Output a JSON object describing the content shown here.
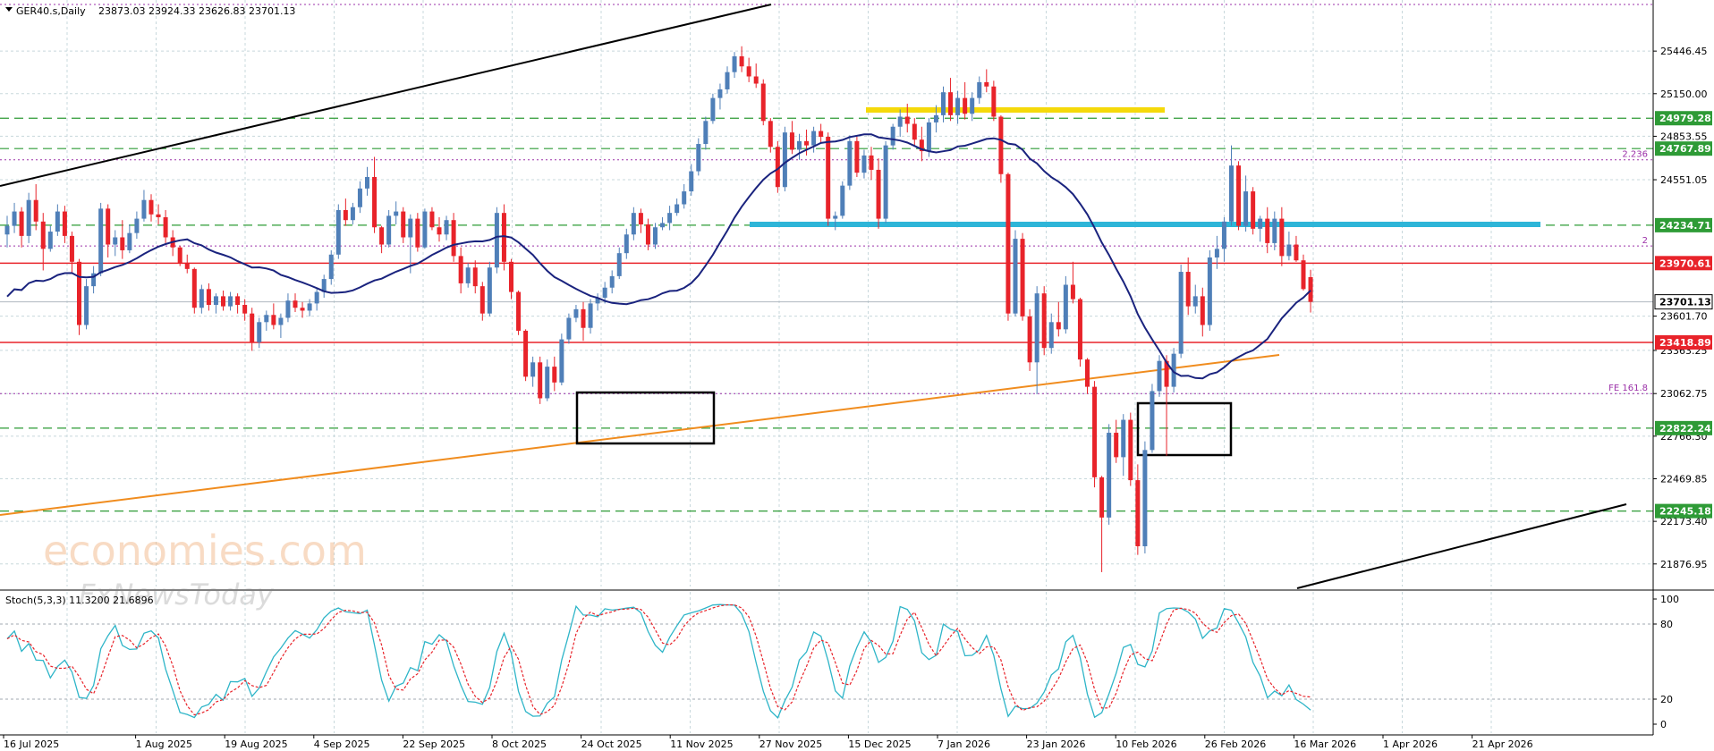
{
  "header": {
    "symbol": "GER40.s,Daily",
    "ohlc": "23873.03 23924.33 23626.83 23701.13",
    "menu_icon": "triangle-down-icon"
  },
  "watermark": {
    "line1": "economies.com",
    "line2": "FxNewsToday"
  },
  "indicator": {
    "title": "Stoch(5,3,3) 11.3200 21.6896"
  },
  "colors": {
    "background": "#ffffff",
    "grid": "#c8d8dc",
    "bull": "#4f7fb8",
    "bear": "#e8232a",
    "ma": "#1a237e",
    "support_red": "#e8232a",
    "green_level": "#2e9b36",
    "yellow_zone": "#f5d90a",
    "cyan_zone": "#2eb5d8",
    "orange_trend": "#f08c1e",
    "channel": "#000000",
    "fib": "#9b30a8",
    "stoch_main": "#2eb5c8",
    "stoch_signal": "#e8232a"
  },
  "chart_data": {
    "type": "candlestick",
    "symbol": "GER40.s",
    "timeframe": "Daily",
    "y_range": [
      21720,
      25690
    ],
    "price_labels": [
      "25446.45",
      "25150.00",
      "24853.55",
      "24551.05",
      "23601.70",
      "23363.25",
      "23062.75",
      "22766.30",
      "22469.85",
      "22173.40",
      "21876.95"
    ],
    "hidden_price_labels": [
      25150.0,
      24551.05,
      23601.7,
      23363.25,
      22766.3,
      22173.4
    ],
    "dates": [
      "16 Jul 2025",
      "1 Aug 2025",
      "19 Aug 2025",
      "4 Sep 2025",
      "22 Sep 2025",
      "8 Oct 2025",
      "24 Oct 2025",
      "11 Nov 2025",
      "27 Nov 2025",
      "15 Dec 2025",
      "7 Jan 2026",
      "23 Jan 2026",
      "10 Feb 2026",
      "26 Feb 2026",
      "16 Mar 2026",
      "1 Apr 2026",
      "21 Apr 2026"
    ],
    "level_lines": [
      {
        "price": 24979.28,
        "label": "24979.28",
        "style": "green-dashed"
      },
      {
        "price": 24767.89,
        "label": "24767.89",
        "style": "green-dashed"
      },
      {
        "price": 24234.71,
        "label": "24234.71",
        "style": "green-dashed"
      },
      {
        "price": 23970.61,
        "label": "23970.61",
        "style": "red-solid"
      },
      {
        "price": 23701.13,
        "label": "23701.13",
        "style": "current"
      },
      {
        "price": 23418.89,
        "label": "23418.89",
        "style": "red-solid"
      },
      {
        "price": 22822.24,
        "label": "22822.24",
        "style": "green-dashed"
      },
      {
        "price": 22245.18,
        "label": "22245.18",
        "style": "green-dashed"
      }
    ],
    "fib_lines": [
      {
        "price": 24690,
        "label": "2.236"
      },
      {
        "price": 24090,
        "label": "2"
      },
      {
        "price": 23062.75,
        "label": "FE 161.8"
      }
    ],
    "candles": [
      [
        24170,
        24300,
        24080,
        24230
      ],
      [
        24230,
        24390,
        24180,
        24330
      ],
      [
        24330,
        24360,
        24080,
        24160
      ],
      [
        24160,
        24460,
        24110,
        24410
      ],
      [
        24410,
        24520,
        24200,
        24260
      ],
      [
        24260,
        24320,
        23920,
        24070
      ],
      [
        24070,
        24230,
        24050,
        24190
      ],
      [
        24190,
        24380,
        24160,
        24330
      ],
      [
        24330,
        24370,
        24110,
        24160
      ],
      [
        24160,
        24190,
        23900,
        23980
      ],
      [
        23980,
        24000,
        23470,
        23540
      ],
      [
        23540,
        23860,
        23510,
        23810
      ],
      [
        23810,
        23950,
        23760,
        23900
      ],
      [
        23900,
        24390,
        23880,
        24350
      ],
      [
        24350,
        24380,
        24010,
        24100
      ],
      [
        24100,
        24200,
        24020,
        24150
      ],
      [
        24150,
        24270,
        24000,
        24060
      ],
      [
        24060,
        24240,
        24040,
        24180
      ],
      [
        24180,
        24330,
        24140,
        24280
      ],
      [
        24280,
        24480,
        24260,
        24410
      ],
      [
        24410,
        24450,
        24260,
        24310
      ],
      [
        24310,
        24380,
        24240,
        24290
      ],
      [
        24290,
        24340,
        24110,
        24150
      ],
      [
        24150,
        24200,
        24020,
        24080
      ],
      [
        24080,
        24090,
        23950,
        23970
      ],
      [
        23970,
        24030,
        23900,
        23930
      ],
      [
        23930,
        23940,
        23620,
        23660
      ],
      [
        23660,
        23820,
        23620,
        23790
      ],
      [
        23790,
        23830,
        23640,
        23680
      ],
      [
        23680,
        23760,
        23620,
        23740
      ],
      [
        23740,
        23780,
        23640,
        23670
      ],
      [
        23670,
        23770,
        23640,
        23740
      ],
      [
        23740,
        23760,
        23620,
        23680
      ],
      [
        23680,
        23720,
        23570,
        23620
      ],
      [
        23620,
        23660,
        23360,
        23420
      ],
      [
        23420,
        23590,
        23380,
        23560
      ],
      [
        23560,
        23640,
        23500,
        23610
      ],
      [
        23610,
        23690,
        23510,
        23540
      ],
      [
        23540,
        23620,
        23450,
        23590
      ],
      [
        23590,
        23760,
        23560,
        23710
      ],
      [
        23710,
        23760,
        23630,
        23660
      ],
      [
        23660,
        23700,
        23590,
        23640
      ],
      [
        23640,
        23720,
        23600,
        23690
      ],
      [
        23690,
        23800,
        23640,
        23770
      ],
      [
        23770,
        23890,
        23730,
        23860
      ],
      [
        23860,
        24060,
        23820,
        24030
      ],
      [
        24030,
        24380,
        24000,
        24340
      ],
      [
        24340,
        24420,
        24230,
        24270
      ],
      [
        24270,
        24390,
        24240,
        24360
      ],
      [
        24360,
        24540,
        24320,
        24490
      ],
      [
        24490,
        24640,
        24440,
        24570
      ],
      [
        24570,
        24710,
        24180,
        24220
      ],
      [
        24220,
        24230,
        24040,
        24100
      ],
      [
        24100,
        24340,
        24080,
        24300
      ],
      [
        24300,
        24400,
        24240,
        24330
      ],
      [
        24330,
        24360,
        24110,
        24150
      ],
      [
        24150,
        24310,
        23900,
        24280
      ],
      [
        24280,
        24320,
        24050,
        24080
      ],
      [
        24080,
        24350,
        24070,
        24330
      ],
      [
        24330,
        24360,
        24200,
        24220
      ],
      [
        24220,
        24290,
        24120,
        24170
      ],
      [
        24170,
        24300,
        24130,
        24270
      ],
      [
        24270,
        24320,
        23980,
        24020
      ],
      [
        24020,
        24080,
        23760,
        23830
      ],
      [
        23830,
        23970,
        23800,
        23940
      ],
      [
        23940,
        23990,
        23760,
        23810
      ],
      [
        23810,
        23840,
        23570,
        23620
      ],
      [
        23620,
        23980,
        23600,
        23940
      ],
      [
        23940,
        24360,
        23900,
        24320
      ],
      [
        24320,
        24380,
        23920,
        23980
      ],
      [
        23980,
        24000,
        23720,
        23770
      ],
      [
        23770,
        23780,
        23470,
        23500
      ],
      [
        23500,
        23510,
        23150,
        23180
      ],
      [
        23180,
        23320,
        23110,
        23280
      ],
      [
        23280,
        23320,
        22990,
        23030
      ],
      [
        23030,
        23300,
        23010,
        23250
      ],
      [
        23250,
        23320,
        23080,
        23140
      ],
      [
        23140,
        23480,
        23120,
        23440
      ],
      [
        23440,
        23620,
        23410,
        23590
      ],
      [
        23590,
        23680,
        23560,
        23650
      ],
      [
        23650,
        23700,
        23430,
        23520
      ],
      [
        23520,
        23720,
        23480,
        23690
      ],
      [
        23690,
        23760,
        23640,
        23730
      ],
      [
        23730,
        23840,
        23690,
        23800
      ],
      [
        23800,
        23920,
        23760,
        23880
      ],
      [
        23880,
        24080,
        23860,
        24040
      ],
      [
        24040,
        24210,
        24000,
        24170
      ],
      [
        24170,
        24360,
        24130,
        24320
      ],
      [
        24320,
        24350,
        24180,
        24240
      ],
      [
        24240,
        24280,
        24060,
        24100
      ],
      [
        24100,
        24250,
        24070,
        24220
      ],
      [
        24220,
        24290,
        24200,
        24250
      ],
      [
        24250,
        24370,
        24200,
        24320
      ],
      [
        24320,
        24420,
        24300,
        24380
      ],
      [
        24380,
        24520,
        24350,
        24470
      ],
      [
        24470,
        24660,
        24440,
        24610
      ],
      [
        24610,
        24840,
        24580,
        24800
      ],
      [
        24800,
        24990,
        24760,
        24960
      ],
      [
        24960,
        25150,
        24940,
        25120
      ],
      [
        25120,
        25220,
        25040,
        25180
      ],
      [
        25180,
        25340,
        25150,
        25300
      ],
      [
        25300,
        25440,
        25260,
        25410
      ],
      [
        25410,
        25480,
        25300,
        25340
      ],
      [
        25340,
        25400,
        25230,
        25270
      ],
      [
        25270,
        25360,
        25190,
        25220
      ],
      [
        25220,
        25250,
        24930,
        24960
      ],
      [
        24960,
        24980,
        24740,
        24780
      ],
      [
        24780,
        24820,
        24460,
        24500
      ],
      [
        24500,
        24920,
        24470,
        24880
      ],
      [
        24880,
        24960,
        24730,
        24760
      ],
      [
        24760,
        24870,
        24690,
        24820
      ],
      [
        24820,
        24900,
        24720,
        24790
      ],
      [
        24790,
        24920,
        24740,
        24890
      ],
      [
        24890,
        24940,
        24810,
        24850
      ],
      [
        24850,
        24880,
        24230,
        24280
      ],
      [
        24280,
        24330,
        24200,
        24300
      ],
      [
        24300,
        24540,
        24280,
        24510
      ],
      [
        24510,
        24860,
        24480,
        24820
      ],
      [
        24820,
        24850,
        24570,
        24600
      ],
      [
        24600,
        24760,
        24560,
        24720
      ],
      [
        24720,
        24780,
        24550,
        24620
      ],
      [
        24620,
        24700,
        24210,
        24280
      ],
      [
        24280,
        24820,
        24250,
        24790
      ],
      [
        24790,
        24940,
        24760,
        24920
      ],
      [
        24920,
        25040,
        24850,
        24990
      ],
      [
        24990,
        25080,
        24880,
        24940
      ],
      [
        24940,
        24980,
        24790,
        24830
      ],
      [
        24830,
        24920,
        24680,
        24750
      ],
      [
        24750,
        24980,
        24710,
        24950
      ],
      [
        24950,
        25070,
        24880,
        25000
      ],
      [
        25000,
        25200,
        24950,
        25160
      ],
      [
        25160,
        25260,
        24960,
        25000
      ],
      [
        25000,
        25170,
        24940,
        25120
      ],
      [
        25120,
        25230,
        24970,
        25010
      ],
      [
        25010,
        25160,
        24960,
        25120
      ],
      [
        25120,
        25270,
        25080,
        25230
      ],
      [
        25230,
        25320,
        25160,
        25200
      ],
      [
        25200,
        25240,
        24960,
        24990
      ],
      [
        24990,
        25000,
        24530,
        24590
      ],
      [
        24590,
        24600,
        23570,
        23620
      ],
      [
        23620,
        24200,
        23600,
        24140
      ],
      [
        24140,
        24180,
        23570,
        23600
      ],
      [
        23600,
        23650,
        23220,
        23280
      ],
      [
        23280,
        23810,
        23060,
        23760
      ],
      [
        23760,
        23810,
        23330,
        23380
      ],
      [
        23380,
        23620,
        23340,
        23560
      ],
      [
        23560,
        23700,
        23460,
        23510
      ],
      [
        23510,
        23880,
        23480,
        23820
      ],
      [
        23820,
        23980,
        23690,
        23720
      ],
      [
        23720,
        23730,
        23250,
        23300
      ],
      [
        23300,
        23310,
        23060,
        23110
      ],
      [
        23110,
        23150,
        22410,
        22480
      ],
      [
        22480,
        22490,
        21820,
        22200
      ],
      [
        22200,
        22850,
        22150,
        22790
      ],
      [
        22790,
        22880,
        22580,
        22620
      ],
      [
        22620,
        22920,
        22490,
        22880
      ],
      [
        22880,
        22930,
        22420,
        22460
      ],
      [
        22460,
        22570,
        21940,
        22000
      ],
      [
        22000,
        22730,
        21950,
        22670
      ],
      [
        22670,
        23130,
        22650,
        23080
      ],
      [
        23080,
        23330,
        23040,
        23290
      ],
      [
        23290,
        23330,
        22630,
        23110
      ],
      [
        23110,
        23380,
        23070,
        23340
      ],
      [
        23340,
        23960,
        23310,
        23910
      ],
      [
        23910,
        24010,
        23610,
        23670
      ],
      [
        23670,
        23820,
        23620,
        23740
      ],
      [
        23740,
        23800,
        23460,
        23540
      ],
      [
        23540,
        24060,
        23500,
        24010
      ],
      [
        24010,
        24160,
        23930,
        24070
      ],
      [
        24070,
        24290,
        23980,
        24260
      ],
      [
        24260,
        24790,
        24230,
        24650
      ],
      [
        24650,
        24680,
        24200,
        24230
      ],
      [
        24230,
        24580,
        24190,
        24470
      ],
      [
        24470,
        24500,
        24170,
        24210
      ],
      [
        24210,
        24300,
        24120,
        24280
      ],
      [
        24280,
        24360,
        24040,
        24110
      ],
      [
        24110,
        24330,
        24060,
        24280
      ],
      [
        24280,
        24360,
        23950,
        24020
      ],
      [
        24020,
        24190,
        23990,
        24100
      ],
      [
        24100,
        24160,
        23980,
        23990
      ],
      [
        23990,
        24030,
        23780,
        23790
      ],
      [
        23873.03,
        23924.33,
        23626.83,
        23701.13
      ]
    ],
    "stoch_ylabels": [
      "100",
      "80",
      "20",
      "0"
    ],
    "stoch_levels": [
      80,
      20
    ],
    "stoch_last": {
      "main": 11.32,
      "signal": 21.6896
    }
  }
}
